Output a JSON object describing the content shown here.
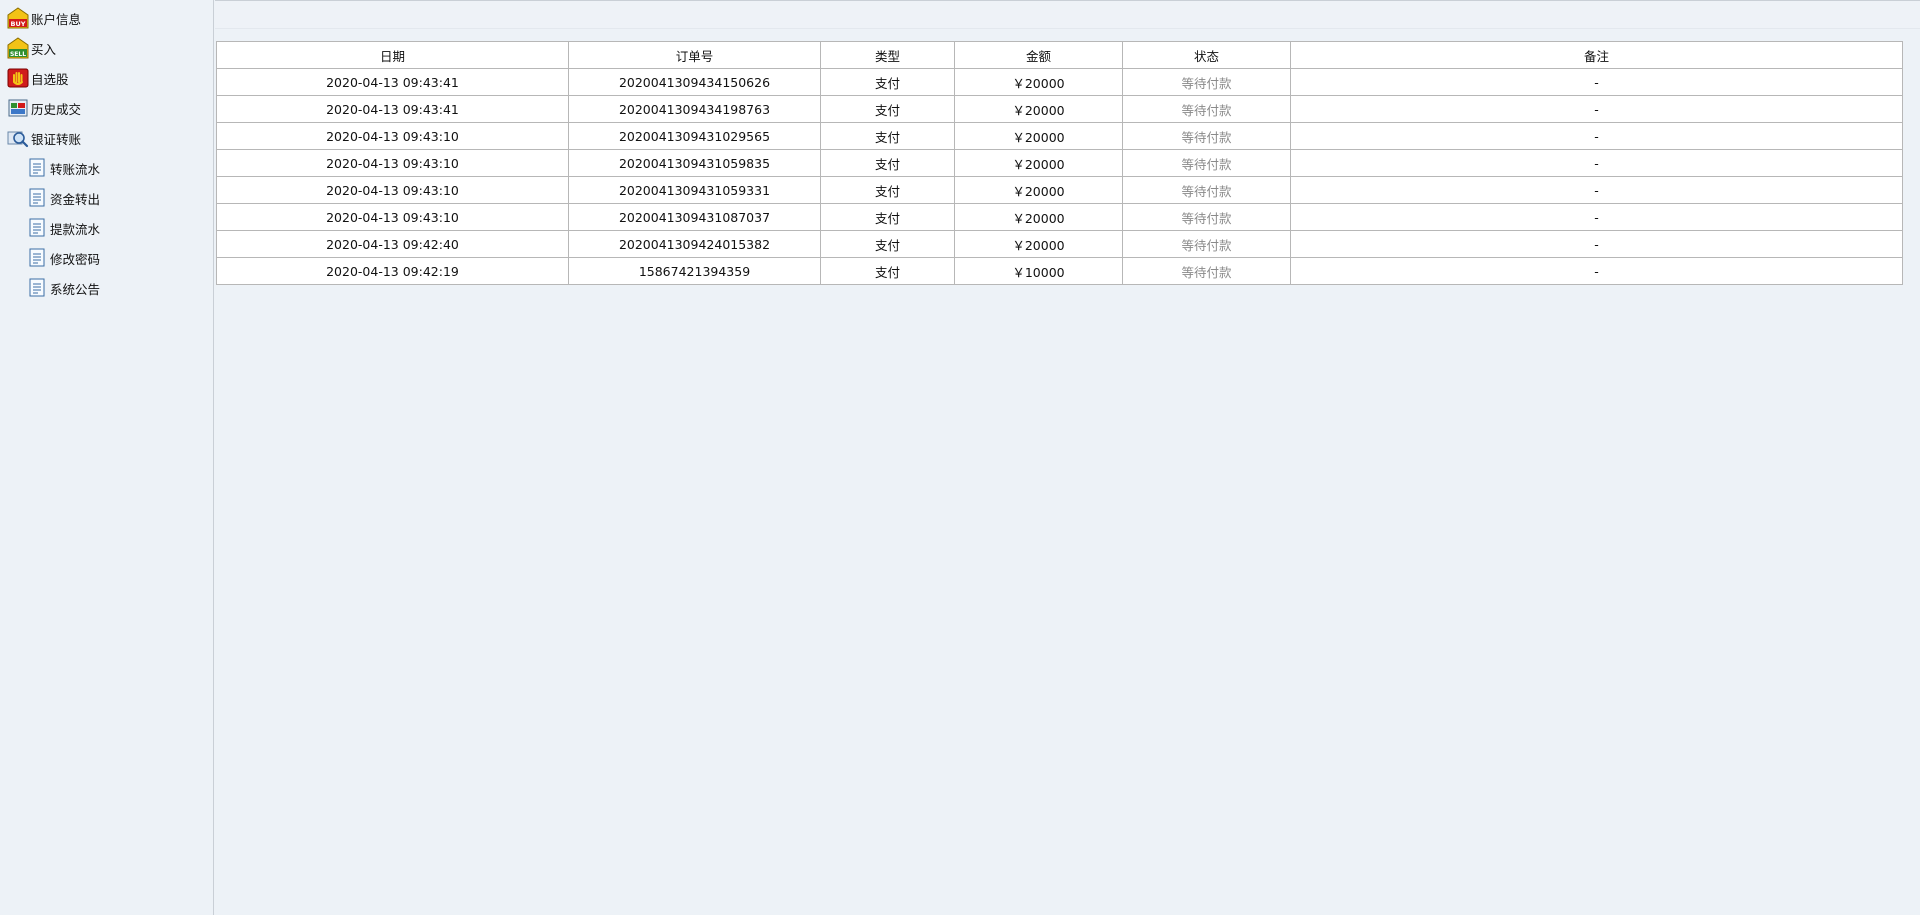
{
  "sidebar": {
    "items": [
      {
        "label": "账户信息",
        "icon": "buy-icon"
      },
      {
        "label": "买入",
        "icon": "sell-icon"
      },
      {
        "label": "自选股",
        "icon": "hand-icon"
      },
      {
        "label": "历史成交",
        "icon": "trade-history-icon"
      },
      {
        "label": "银证转账",
        "icon": "transfer-search-icon"
      },
      {
        "label": "转账流水",
        "icon": "document-icon"
      },
      {
        "label": "资金转出",
        "icon": "document-icon"
      },
      {
        "label": "提款流水",
        "icon": "document-icon"
      },
      {
        "label": "修改密码",
        "icon": "document-icon"
      },
      {
        "label": "系统公告",
        "icon": "document-icon"
      }
    ]
  },
  "table": {
    "headers": [
      "日期",
      "订单号",
      "类型",
      "金额",
      "状态",
      "备注"
    ],
    "rows": [
      {
        "date": "2020-04-13 09:43:41",
        "order": "2020041309434150626",
        "type": "支付",
        "amount": "￥20000",
        "status": "等待付款",
        "note": "-"
      },
      {
        "date": "2020-04-13 09:43:41",
        "order": "2020041309434198763",
        "type": "支付",
        "amount": "￥20000",
        "status": "等待付款",
        "note": "-"
      },
      {
        "date": "2020-04-13 09:43:10",
        "order": "2020041309431029565",
        "type": "支付",
        "amount": "￥20000",
        "status": "等待付款",
        "note": "-"
      },
      {
        "date": "2020-04-13 09:43:10",
        "order": "2020041309431059835",
        "type": "支付",
        "amount": "￥20000",
        "status": "等待付款",
        "note": "-"
      },
      {
        "date": "2020-04-13 09:43:10",
        "order": "2020041309431059331",
        "type": "支付",
        "amount": "￥20000",
        "status": "等待付款",
        "note": "-"
      },
      {
        "date": "2020-04-13 09:43:10",
        "order": "2020041309431087037",
        "type": "支付",
        "amount": "￥20000",
        "status": "等待付款",
        "note": "-"
      },
      {
        "date": "2020-04-13 09:42:40",
        "order": "2020041309424015382",
        "type": "支付",
        "amount": "￥20000",
        "status": "等待付款",
        "note": "-"
      },
      {
        "date": "2020-04-13 09:42:19",
        "order": "15867421394359",
        "type": "支付",
        "amount": "￥10000",
        "status": "等待付款",
        "note": "-"
      }
    ]
  },
  "colors": {
    "background": "#edf2f7",
    "status_text": "#8a8a8a",
    "border": "#b7b7b7"
  }
}
